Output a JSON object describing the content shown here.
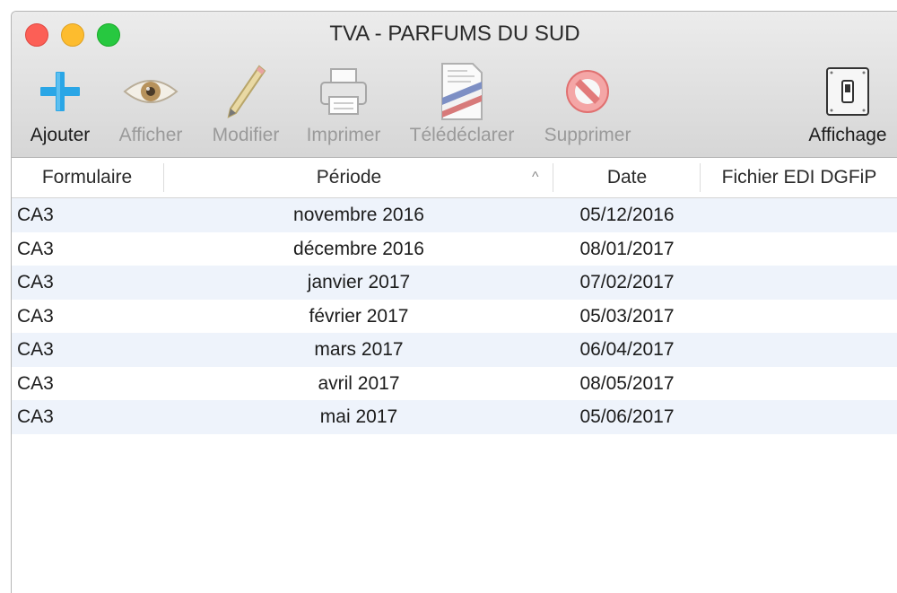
{
  "window": {
    "title": "TVA - PARFUMS DU SUD"
  },
  "toolbar": {
    "add_label": "Ajouter",
    "view_label": "Afficher",
    "edit_label": "Modifier",
    "print_label": "Imprimer",
    "teledeclare_label": "Télédéclarer",
    "delete_label": "Supprimer",
    "display_label": "Affichage"
  },
  "table": {
    "columns": [
      "Formulaire",
      "Période",
      "Date",
      "Fichier EDI DGFiP"
    ],
    "sort_indicator": "^",
    "rows": [
      {
        "form": "CA3",
        "period": "novembre 2016",
        "date": "05/12/2016",
        "edi": ""
      },
      {
        "form": "CA3",
        "period": "décembre 2016",
        "date": "08/01/2017",
        "edi": ""
      },
      {
        "form": "CA3",
        "period": "janvier 2017",
        "date": "07/02/2017",
        "edi": ""
      },
      {
        "form": "CA3",
        "period": "février 2017",
        "date": "05/03/2017",
        "edi": ""
      },
      {
        "form": "CA3",
        "period": "mars 2017",
        "date": "06/04/2017",
        "edi": ""
      },
      {
        "form": "CA3",
        "period": "avril 2017",
        "date": "08/05/2017",
        "edi": ""
      },
      {
        "form": "CA3",
        "period": "mai 2017",
        "date": "05/06/2017",
        "edi": ""
      }
    ]
  },
  "colors": {
    "row_alt": "#eef3fb",
    "add_icon": "#2aa6e6",
    "delete_icon": "#e45a5a"
  }
}
